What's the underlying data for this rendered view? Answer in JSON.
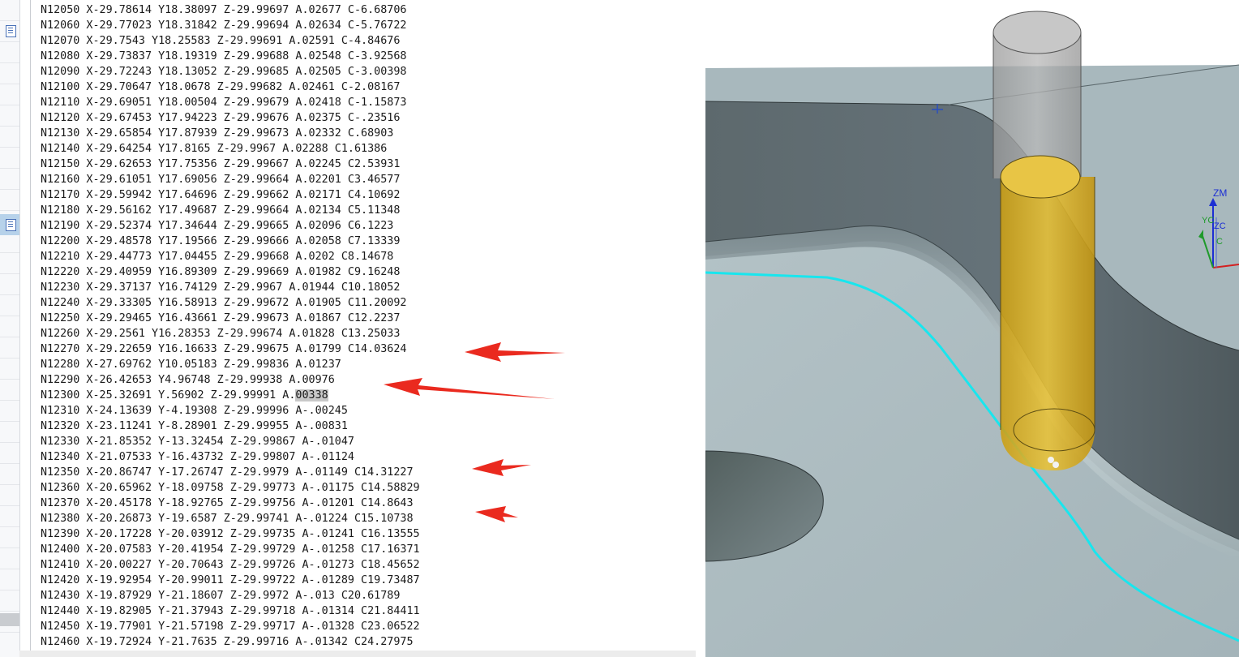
{
  "nc_program": {
    "lines": [
      "N12050 X-29.78614 Y18.38097 Z-29.99697 A.02677 C-6.68706",
      "N12060 X-29.77023 Y18.31842 Z-29.99694 A.02634 C-5.76722",
      "N12070 X-29.7543 Y18.25583 Z-29.99691 A.02591 C-4.84676",
      "N12080 X-29.73837 Y18.19319 Z-29.99688 A.02548 C-3.92568",
      "N12090 X-29.72243 Y18.13052 Z-29.99685 A.02505 C-3.00398",
      "N12100 X-29.70647 Y18.0678 Z-29.99682 A.02461 C-2.08167",
      "N12110 X-29.69051 Y18.00504 Z-29.99679 A.02418 C-1.15873",
      "N12120 X-29.67453 Y17.94223 Z-29.99676 A.02375 C-.23516",
      "N12130 X-29.65854 Y17.87939 Z-29.99673 A.02332 C.68903",
      "N12140 X-29.64254 Y17.8165 Z-29.9967 A.02288 C1.61386",
      "N12150 X-29.62653 Y17.75356 Z-29.99667 A.02245 C2.53931",
      "N12160 X-29.61051 Y17.69056 Z-29.99664 A.02201 C3.46577",
      "N12170 X-29.59942 Y17.64696 Z-29.99662 A.02171 C4.10692",
      "N12180 X-29.56162 Y17.49687 Z-29.99664 A.02134 C5.11348",
      "N12190 X-29.52374 Y17.34644 Z-29.99665 A.02096 C6.1223",
      "N12200 X-29.48578 Y17.19566 Z-29.99666 A.02058 C7.13339",
      "N12210 X-29.44773 Y17.04455 Z-29.99668 A.0202 C8.14678",
      "N12220 X-29.40959 Y16.89309 Z-29.99669 A.01982 C9.16248",
      "N12230 X-29.37137 Y16.74129 Z-29.9967 A.01944 C10.18052",
      "N12240 X-29.33305 Y16.58913 Z-29.99672 A.01905 C11.20092",
      "N12250 X-29.29465 Y16.43661 Z-29.99673 A.01867 C12.2237",
      "N12260 X-29.2561 Y16.28353 Z-29.99674 A.01828 C13.25033",
      "N12270 X-29.22659 Y16.16633 Z-29.99675 A.01799 C14.03624",
      "N12280 X-27.69762 Y10.05183 Z-29.99836 A.01237",
      "N12290 X-26.42653 Y4.96748 Z-29.99938 A.00976",
      "N12300 X-25.32691 Y.56902 Z-29.99991 A.00338",
      "N12310 X-24.13639 Y-4.19308 Z-29.99996 A-.00245",
      "N12320 X-23.11241 Y-8.28901 Z-29.99955 A-.00831",
      "N12330 X-21.85352 Y-13.32454 Z-29.99867 A-.01047",
      "N12340 X-21.07533 Y-16.43732 Z-29.99807 A-.01124",
      "N12350 X-20.86747 Y-17.26747 Z-29.9979 A-.01149 C14.31227",
      "N12360 X-20.65962 Y-18.09758 Z-29.99773 A-.01175 C14.58829",
      "N12370 X-20.45178 Y-18.92765 Z-29.99756 A-.01201 C14.8643",
      "N12380 X-20.26873 Y-19.6587 Z-29.99741 A-.01224 C15.10738",
      "N12390 X-20.17228 Y-20.03912 Z-29.99735 A-.01241 C16.13555",
      "N12400 X-20.07583 Y-20.41954 Z-29.99729 A-.01258 C17.16371",
      "N12410 X-20.00227 Y-20.70643 Z-29.99726 A-.01273 C18.45652",
      "N12420 X-19.92954 Y-20.99011 Z-29.99722 A-.01289 C19.73487",
      "N12430 X-19.87929 Y-21.18607 Z-29.9972 A-.013 C20.61789",
      "N12440 X-19.82905 Y-21.37943 Z-29.99718 A-.01314 C21.84411",
      "N12450 X-19.77901 Y-21.57198 Z-29.99717 A-.01328 C23.06522",
      "N12460 X-19.72924 Y-21.7635 Z-29.99716 A-.01342 C24.27975"
    ],
    "selection": {
      "line_index": 25,
      "before": "N12300 X-25.32691 Y.56902 Z-29.99991 A.",
      "selected": "00338"
    }
  },
  "scrollbar": {
    "down_arrow": "▾"
  },
  "viewport": {
    "axis_labels": {
      "zm": "ZM",
      "zc": "ZC",
      "yc": "YC",
      "c": "C"
    },
    "colors": {
      "part_top": "#a8b8bd",
      "wall_dark": "#5b676b",
      "toolpath": "#18e6ee",
      "tool_holder": "#a9a9a9",
      "tool_cutter": "#e0b523",
      "annotation_arrow": "#ea2a1f"
    }
  }
}
